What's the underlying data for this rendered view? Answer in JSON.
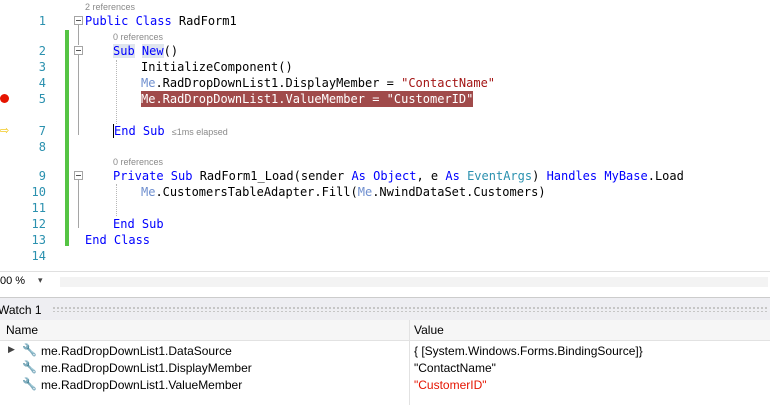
{
  "editor": {
    "lines": [
      {
        "num": "1",
        "lens": "2 references"
      },
      {
        "num": "2",
        "lens": "0 references"
      },
      {
        "num": "3"
      },
      {
        "num": "4"
      },
      {
        "num": "5"
      },
      {
        "num": "7"
      },
      {
        "num": "8"
      },
      {
        "num": "9",
        "lens": "0 references"
      },
      {
        "num": "10"
      },
      {
        "num": "11"
      },
      {
        "num": "12"
      },
      {
        "num": "13"
      },
      {
        "num": "14"
      }
    ],
    "code": {
      "l1_kw": "Public Class",
      "l1_name": " RadForm1",
      "l2_kw1": "Sub",
      "l2_kw2": "New",
      "l2_rest": "()",
      "l3": "InitializeComponent()",
      "l4_me": "Me",
      "l4_rest": ".RadDropDownList1.DisplayMember = ",
      "l4_str": "\"ContactName\"",
      "l5_me": "Me",
      "l5_rest": ".RadDropDownList1.ValueMember = ",
      "l5_str": "\"CustomerID\"",
      "l7_kw": "End Sub",
      "l7_elapsed": "≤1ms elapsed",
      "l9_kw1": "Private Sub",
      "l9_name": " RadForm1_Load(sender ",
      "l9_as1": "As",
      "l9_t1": "Object",
      "l9_mid": ", e ",
      "l9_as2": "As",
      "l9_t2": "EventArgs",
      "l9_sp": ") ",
      "l9_handles": "Handles",
      "l9_mybase": "MyBase",
      "l9_load": ".Load",
      "l10_me": "Me",
      "l10_mid": ".CustomersTableAdapter.Fill(",
      "l10_me2": "Me",
      "l10_rest": ".NwindDataSet.Customers)",
      "l12_kw": "End Sub",
      "l13_kw": "End Class"
    }
  },
  "status": {
    "zoom": "00 %",
    "zoom_arrow": "▾"
  },
  "watch": {
    "title": "Watch 1",
    "col_name": "Name",
    "col_value": "Value",
    "rows": [
      {
        "name": "me.RadDropDownList1.DataSource",
        "value": "{ [System.Windows.Forms.BindingSource]}"
      },
      {
        "name": "me.RadDropDownList1.DisplayMember",
        "value": "\"ContactName\""
      },
      {
        "name": "me.RadDropDownList1.ValueMember",
        "value": "\"CustomerID\""
      }
    ]
  },
  "colors": {
    "breakpoint": "#e51400",
    "current_line_highlight": "#a04a4a",
    "changed_value": "#e51400",
    "change_bar": "#55c444",
    "line_number": "#2b91af"
  },
  "icons": [
    "breakpoint-icon",
    "execution-arrow-icon",
    "wrench-icon",
    "expand-arrow-icon"
  ]
}
